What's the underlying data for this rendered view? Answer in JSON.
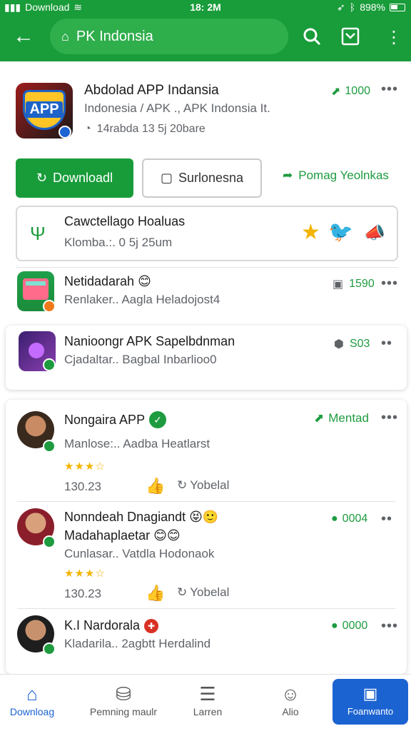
{
  "status": {
    "left_text": "Download",
    "time": "18: 2M",
    "battery": "898%"
  },
  "appbar": {
    "search_text": "PK Indonsia"
  },
  "main_app": {
    "title": "Abdolad APP Indansia",
    "subtitle": "Indonesia / APK ., APK Indonsia It.",
    "meta": "14rabda 13 5j 20bare",
    "count": "1000",
    "icon_text": "APP"
  },
  "actions": {
    "download": "Downloadl",
    "secondary": "Surlonesna",
    "tonal": "Pomag Yeolnkas"
  },
  "feature_card": {
    "title": "Cawctellago Hoaluas",
    "sub": "Klomba.:. 0 5j 25um"
  },
  "list": [
    {
      "title": "Netidadarah 😊",
      "sub": "Renlaker.. Aagla Heladojost4",
      "count": "1590"
    },
    {
      "title": "Nanioongr APK Sapelbdnman",
      "sub": "Cjadaltar.. Bagbal Inbarlioo0",
      "count": "S03"
    }
  ],
  "reviews": [
    {
      "title": "Nongaira APP",
      "sub": "Manlose:.. Aadba Heatlarst",
      "top_right": "Mentad",
      "time": "130.23",
      "reply": "Yobelal",
      "stars": "★★★☆"
    },
    {
      "title": "Nonndeah Dnagiandt 😝🙂",
      "title2": "Madahaplaetar 😊😊",
      "sub": "Cunlasar.. Vatdla Hodonaok",
      "top_right": "0004",
      "time": "130.23",
      "reply": "Yobelal",
      "stars": "★★★☆"
    },
    {
      "title": "K.I Nardorala",
      "sub": "Kladarila.. 2agbtt Herdalind",
      "top_right": "0000"
    }
  ],
  "bottom_nav": [
    "Downloag",
    "Pemning maulr",
    "Larren",
    "Alio",
    "Foanwanto"
  ],
  "colors": {
    "brand_green": "#199C3A",
    "accent_blue": "#1C63D2"
  }
}
